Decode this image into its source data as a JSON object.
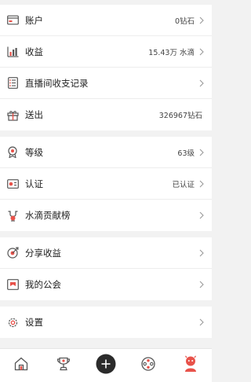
{
  "groups": [
    {
      "items": [
        {
          "icon": "wallet-icon",
          "label": "账户",
          "value": "0钻石",
          "chevron": true
        },
        {
          "icon": "bar-chart-icon",
          "label": "收益",
          "value": "15.43万 水滴",
          "chevron": true
        },
        {
          "icon": "record-list-icon",
          "label": "直播间收支记录",
          "value": "",
          "chevron": true
        },
        {
          "icon": "gift-icon",
          "label": "送出",
          "value": "326967钻石",
          "chevron": false
        }
      ]
    },
    {
      "items": [
        {
          "icon": "level-badge-icon",
          "label": "等级",
          "value": "63级",
          "chevron": true
        },
        {
          "icon": "verify-card-icon",
          "label": "认证",
          "value": "已认证",
          "chevron": true
        },
        {
          "icon": "contribution-rank-icon",
          "label": "水滴贡献榜",
          "value": "",
          "chevron": true
        }
      ]
    },
    {
      "items": [
        {
          "icon": "share-target-icon",
          "label": "分享收益",
          "value": "",
          "chevron": true
        },
        {
          "icon": "guild-flag-icon",
          "label": "我的公会",
          "value": "",
          "chevron": true
        }
      ]
    },
    {
      "items": [
        {
          "icon": "settings-gear-icon",
          "label": "设置",
          "value": "",
          "chevron": true
        }
      ]
    }
  ],
  "tabbar": [
    {
      "icon": "home-icon"
    },
    {
      "icon": "trophy-icon"
    },
    {
      "icon": "add-live-icon"
    },
    {
      "icon": "film-reel-icon"
    },
    {
      "icon": "profile-avatar-icon"
    }
  ],
  "colors": {
    "accent": "#e8524a",
    "icon_dark": "#555555",
    "background": "#f2f2f2"
  }
}
